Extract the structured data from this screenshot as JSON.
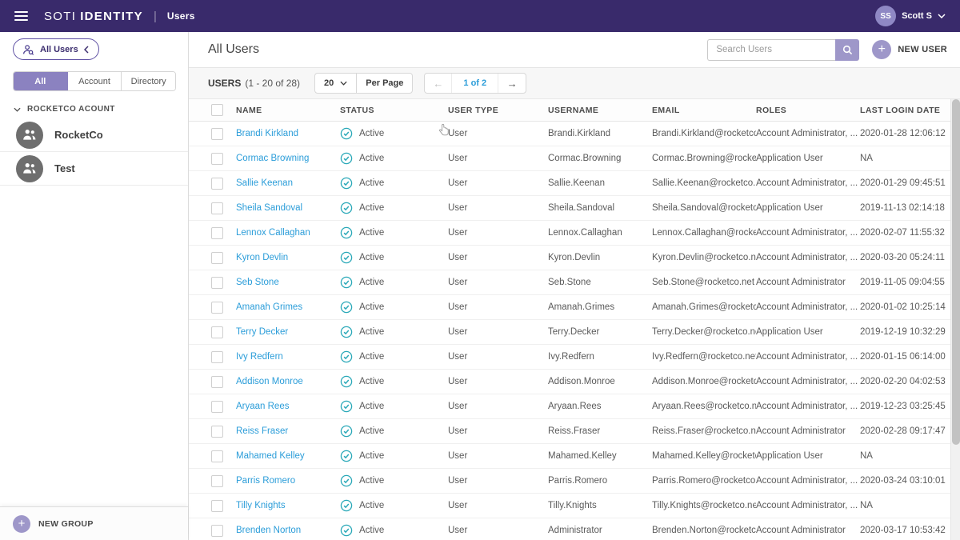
{
  "topbar": {
    "brand_soti": "SOTI",
    "brand_identity": "IDENTITY",
    "brand_separator": "|",
    "section": "Users",
    "user_initials": "SS",
    "user_name": "Scott S"
  },
  "sidebar": {
    "scope_button_label": "All Users",
    "tabs": [
      {
        "label": "All",
        "active": true
      },
      {
        "label": "Account",
        "active": false
      },
      {
        "label": "Directory",
        "active": false
      }
    ],
    "tree_label": "ROCKETCO ACOUNT",
    "groups": [
      {
        "name": "RocketCo"
      },
      {
        "name": "Test"
      }
    ],
    "new_group_label": "NEW GROUP"
  },
  "header": {
    "title": "All Users",
    "search_placeholder": "Search Users",
    "new_user_label": "NEW USER"
  },
  "toolbar": {
    "count_label": "USERS",
    "count_range": "(1 - 20 of 28)",
    "per_page_value": "20",
    "per_page_label": "Per Page",
    "page_label": "1 of 2",
    "prev_icon": "←",
    "next_icon": "→"
  },
  "icons": {
    "plus": "+"
  },
  "colors": {
    "topbar_bg": "#392a6b",
    "accent_purple": "#8b82c0",
    "button_purple": "#9e97c9",
    "link_blue": "#2b9dd9",
    "status_teal": "#29a8b8"
  },
  "table": {
    "columns": [
      "NAME",
      "STATUS",
      "USER TYPE",
      "USERNAME",
      "EMAIL",
      "ROLES",
      "LAST LOGIN DATE"
    ],
    "rows": [
      {
        "name": "Brandi Kirkland",
        "status": "Active",
        "user_type": "User",
        "username": "Brandi.Kirkland",
        "email": "Brandi.Kirkland@rocketco.net",
        "roles": "Account Administrator, ...",
        "last_login": "2020-01-28 12:06:12"
      },
      {
        "name": "Cormac Browning",
        "status": "Active",
        "user_type": "User",
        "username": "Cormac.Browning",
        "email": "Cormac.Browning@rocketc...",
        "roles": "Application User",
        "last_login": "NA"
      },
      {
        "name": "Sallie Keenan",
        "status": "Active",
        "user_type": "User",
        "username": "Sallie.Keenan",
        "email": "Sallie.Keenan@rocketco.net",
        "roles": "Account Administrator, ...",
        "last_login": "2020-01-29 09:45:51"
      },
      {
        "name": "Sheila Sandoval",
        "status": "Active",
        "user_type": "User",
        "username": "Sheila.Sandoval",
        "email": "Sheila.Sandoval@rocketco...",
        "roles": "Application User",
        "last_login": "2019-11-13 02:14:18"
      },
      {
        "name": "Lennox Callaghan",
        "status": "Active",
        "user_type": "User",
        "username": "Lennox.Callaghan",
        "email": "Lennox.Callaghan@rocketc...",
        "roles": "Account Administrator, ...",
        "last_login": "2020-02-07 11:55:32"
      },
      {
        "name": "Kyron Devlin",
        "status": "Active",
        "user_type": "User",
        "username": "Kyron.Devlin",
        "email": "Kyron.Devlin@rocketco.net",
        "roles": "Account Administrator, ...",
        "last_login": "2020-03-20 05:24:11"
      },
      {
        "name": "Seb Stone",
        "status": "Active",
        "user_type": "User",
        "username": "Seb.Stone",
        "email": "Seb.Stone@rocketco.net",
        "roles": "Account Administrator",
        "last_login": "2019-11-05 09:04:55"
      },
      {
        "name": "Amanah Grimes",
        "status": "Active",
        "user_type": "User",
        "username": "Amanah.Grimes",
        "email": "Amanah.Grimes@rocketco...",
        "roles": "Account Administrator, ...",
        "last_login": "2020-01-02 10:25:14"
      },
      {
        "name": "Terry Decker",
        "status": "Active",
        "user_type": "User",
        "username": "Terry.Decker",
        "email": "Terry.Decker@rocketco.net",
        "roles": "Application User",
        "last_login": "2019-12-19 10:32:29"
      },
      {
        "name": "Ivy Redfern",
        "status": "Active",
        "user_type": "User",
        "username": "Ivy.Redfern",
        "email": "Ivy.Redfern@rocketco.net",
        "roles": "Account Administrator, ...",
        "last_login": "2020-01-15 06:14:00"
      },
      {
        "name": "Addison Monroe",
        "status": "Active",
        "user_type": "User",
        "username": "Addison.Monroe",
        "email": "Addison.Monroe@rocketco...",
        "roles": "Account Administrator, ...",
        "last_login": "2020-02-20 04:02:53"
      },
      {
        "name": "Aryaan Rees",
        "status": "Active",
        "user_type": "User",
        "username": "Aryaan.Rees",
        "email": "Aryaan.Rees@rocketco.net",
        "roles": "Account Administrator, ...",
        "last_login": "2019-12-23 03:25:45"
      },
      {
        "name": "Reiss Fraser",
        "status": "Active",
        "user_type": "User",
        "username": "Reiss.Fraser",
        "email": "Reiss.Fraser@rocketco.net",
        "roles": "Account Administrator",
        "last_login": "2020-02-28 09:17:47"
      },
      {
        "name": "Mahamed Kelley",
        "status": "Active",
        "user_type": "User",
        "username": "Mahamed.Kelley",
        "email": "Mahamed.Kelley@rocketco...",
        "roles": "Application User",
        "last_login": "NA"
      },
      {
        "name": "Parris Romero",
        "status": "Active",
        "user_type": "User",
        "username": "Parris.Romero",
        "email": "Parris.Romero@rocketco.net",
        "roles": "Account Administrator, ...",
        "last_login": "2020-03-24 03:10:01"
      },
      {
        "name": "Tilly Knights",
        "status": "Active",
        "user_type": "User",
        "username": "Tilly.Knights",
        "email": "Tilly.Knights@rocketco.net",
        "roles": "Account Administrator, ...",
        "last_login": "NA"
      },
      {
        "name": "Brenden Norton",
        "status": "Active",
        "user_type": "User",
        "username": "Administrator",
        "email": "Brenden.Norton@rocketco.net",
        "roles": "Account Administrator",
        "last_login": "2020-03-17 10:53:42"
      }
    ]
  }
}
